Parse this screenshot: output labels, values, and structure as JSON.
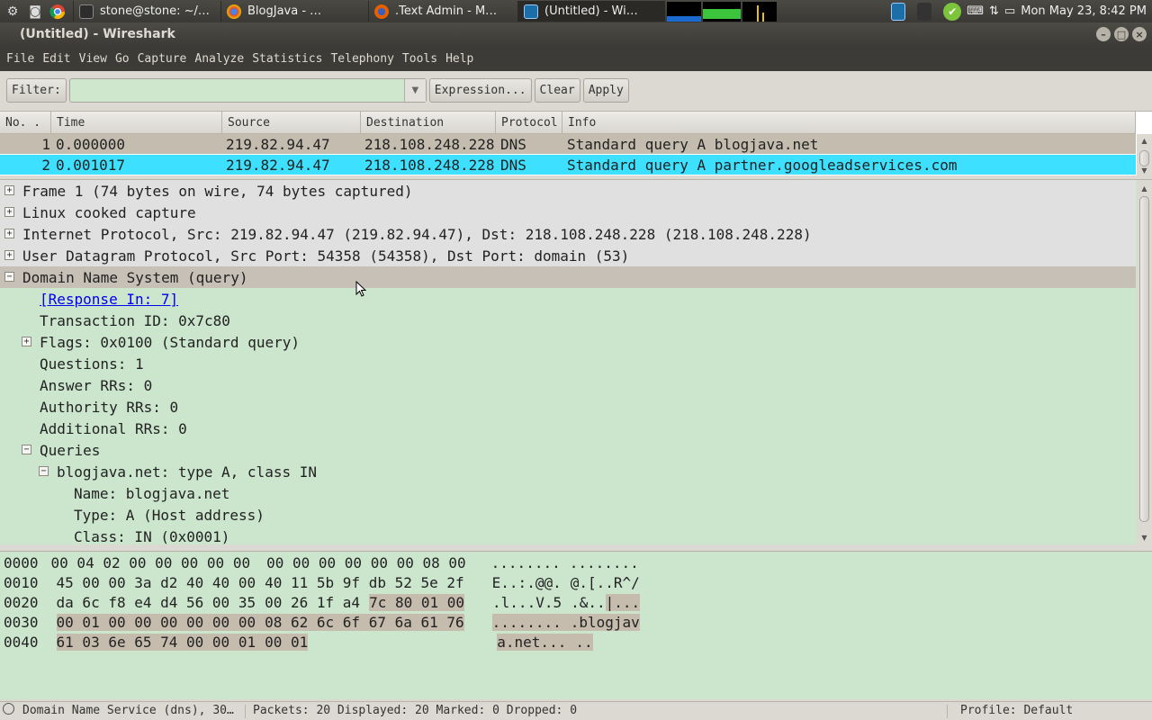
{
  "top_panel": {
    "tasks": [
      {
        "label": "stone@stone: ~/…",
        "icon": "terminal-icon",
        "active": false
      },
      {
        "label": "BlogJava - …",
        "icon": "chrome-icon",
        "active": false
      },
      {
        "label": ".Text Admin - M…",
        "icon": "firefox-icon",
        "active": false
      },
      {
        "label": "(Untitled) - Wi…",
        "icon": "wireshark-icon",
        "active": true
      }
    ],
    "clock": "Mon May 23,  8:42 PM"
  },
  "window": {
    "title": "(Untitled) - Wireshark"
  },
  "menu": [
    "File",
    "Edit",
    "View",
    "Go",
    "Capture",
    "Analyze",
    "Statistics",
    "Telephony",
    "Tools",
    "Help"
  ],
  "filter": {
    "label": "Filter:",
    "value": "",
    "expression_label": "Expression...",
    "clear_label": "Clear",
    "apply_label": "Apply"
  },
  "packet_list": {
    "columns": [
      "No. .",
      "Time",
      "Source",
      "Destination",
      "Protocol",
      "Info"
    ],
    "rows": [
      {
        "no": "1",
        "time": "0.000000",
        "source": "219.82.94.47",
        "destination": "218.108.248.228",
        "protocol": "DNS",
        "info": "Standard query A blogjava.net"
      },
      {
        "no": "2",
        "time": "0.001017",
        "source": "219.82.94.47",
        "destination": "218.108.248.228",
        "protocol": "DNS",
        "info": "Standard query A partner.googleadservices.com"
      }
    ]
  },
  "details": [
    {
      "text": "Frame 1 (74 bytes on wire, 74 bytes captured)",
      "level": 0,
      "expander": "+"
    },
    {
      "text": "Linux cooked capture",
      "level": 0,
      "expander": "+"
    },
    {
      "text": "Internet Protocol, Src: 219.82.94.47 (219.82.94.47), Dst: 218.108.248.228 (218.108.248.228)",
      "level": 0,
      "expander": "+"
    },
    {
      "text": "User Datagram Protocol, Src Port: 54358 (54358), Dst Port: domain (53)",
      "level": 0,
      "expander": "+"
    },
    {
      "text": "Domain Name System (query)",
      "level": 0,
      "expander": "−"
    },
    {
      "text": "[Response In: 7]",
      "level": 1,
      "expander": "",
      "link": true
    },
    {
      "text": "Transaction ID: 0x7c80",
      "level": 1,
      "expander": ""
    },
    {
      "text": "Flags: 0x0100 (Standard query)",
      "level": 1,
      "expander": "+"
    },
    {
      "text": "Questions: 1",
      "level": 1,
      "expander": ""
    },
    {
      "text": "Answer RRs: 0",
      "level": 1,
      "expander": ""
    },
    {
      "text": "Authority RRs: 0",
      "level": 1,
      "expander": ""
    },
    {
      "text": "Additional RRs: 0",
      "level": 1,
      "expander": ""
    },
    {
      "text": "Queries",
      "level": 1,
      "expander": "−"
    },
    {
      "text": "blogjava.net: type A, class IN",
      "level": 2,
      "expander": "−"
    },
    {
      "text": "Name: blogjava.net",
      "level": 3,
      "expander": ""
    },
    {
      "text": "Type: A (Host address)",
      "level": 3,
      "expander": ""
    },
    {
      "text": "Class: IN (0x0001)",
      "level": 3,
      "expander": ""
    }
  ],
  "hex": [
    {
      "offset": "0000",
      "bytes_a": "00 04 02 00 00 00 00 00",
      "bytes_b": "00 00 00 00 00 00 08 00",
      "ascii_a": "........",
      "ascii_b": "........"
    },
    {
      "offset": "0010",
      "bytes_a": "45 00 00 3a d2 40 40 00",
      "bytes_b": "40 11 5b 9f db 52 5e 2f",
      "ascii_a": "E..:.@@.",
      "ascii_b": "@.[..R^/"
    },
    {
      "offset": "0020",
      "bytes_a": "da 6c f8 e4 d4 56 00 35",
      "bytes_b_plain": "00 26 1f a4",
      "bytes_b_hl": "7c 80 01 00",
      "ascii_a": ".l...V.5",
      "ascii_b_plain": ".&..",
      "ascii_b_hl": "|..."
    },
    {
      "offset": "0030",
      "bytes_a": "00 01 00 00 00 00 00 00",
      "bytes_b": "08 62 6c 6f 67 6a 61 76",
      "ascii_a": "........",
      "ascii_b": ".blogjav",
      "highlight": true
    },
    {
      "offset": "0040",
      "bytes_a": "61 03 6e 65 74 00 00 01",
      "bytes_b": "00 01",
      "ascii_a": "a.net...",
      "ascii_b": "..",
      "highlight": true
    }
  ],
  "status": {
    "field": "Domain Name Service (dns), 30…",
    "packets": "Packets: 20 Displayed: 20 Marked: 0 Dropped: 0",
    "profile": "Profile: Default"
  }
}
